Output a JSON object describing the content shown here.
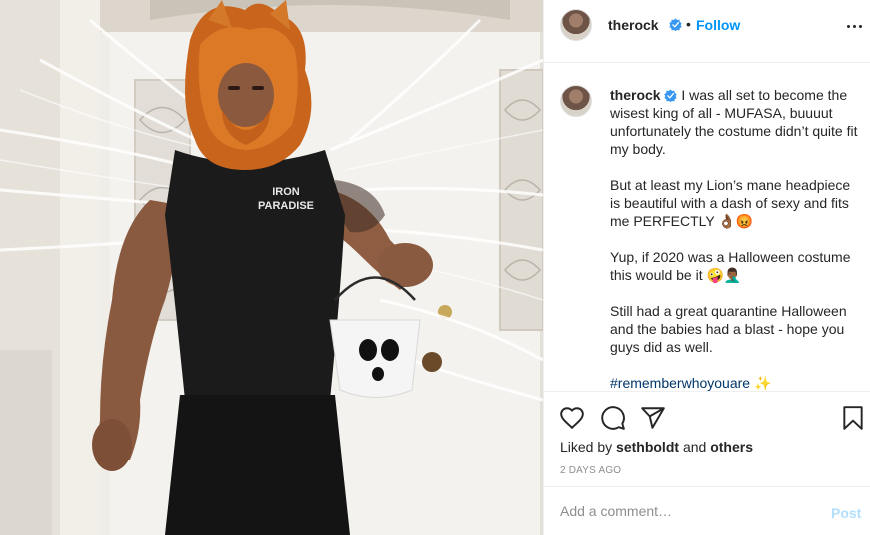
{
  "post": {
    "author": "therock",
    "follow_label": "Follow",
    "separator": "•",
    "photo_shirt_text_line1": "IRON",
    "photo_shirt_text_line2": "PARADISE",
    "caption": {
      "p1": "I was all set to become the wisest king of all - MUFASA, buuuut unfortunately the costume didn’t quite fit my body.",
      "p2": "But at least my Lion’s mane headpiece is beautiful with a dash of sexy and fits me PERFECTLY 👌🏾😡",
      "p3": "Yup, if 2020 was a Halloween costume this would be it 🤪🤦🏾‍♂️",
      "p4": "Still had a great quarantine Halloween and the babies had a blast - hope you guys did as well.",
      "hashtag": "#rememberwhoyouare",
      "hashtag_emoji": "✨"
    },
    "liked_by_prefix": "Liked by",
    "liked_by_user": "sethboldt",
    "liked_by_and": "and",
    "liked_by_others": "others",
    "timestamp": "2 DAYS AGO",
    "comment_placeholder": "Add a comment…",
    "post_button": "Post"
  },
  "colors": {
    "accent_blue": "#0095f6",
    "post_disabled": "#b2dffc",
    "border": "#efefef",
    "text_primary": "#262626",
    "text_secondary": "#8e8e8e",
    "hashtag": "#00376b"
  },
  "icons": {
    "verified": "verified-badge-icon",
    "more": "more-options-icon",
    "like": "heart-icon",
    "comment": "comment-bubble-icon",
    "share": "paper-plane-icon",
    "save": "bookmark-icon"
  }
}
